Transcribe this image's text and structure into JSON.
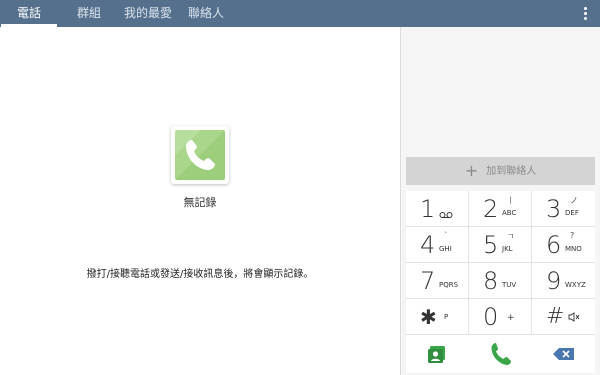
{
  "tabs": [
    {
      "label": "電話",
      "active": true
    },
    {
      "label": "群組",
      "active": false
    },
    {
      "label": "我的最愛",
      "active": false
    },
    {
      "label": "聯絡人",
      "active": false
    }
  ],
  "overflow_icon": "more-vertical-icon",
  "empty_state": {
    "icon": "phone-icon",
    "title": "無記錄",
    "description": "撥打/接聽電話或發送/接收訊息後，將會顯示記錄。"
  },
  "dialpad": {
    "add_contact_label": "加到聯絡人",
    "keys": [
      {
        "digit": "1",
        "letters": "",
        "symbol": "voicemail"
      },
      {
        "digit": "2",
        "letters": "ABC",
        "symbol": "ㅣ"
      },
      {
        "digit": "3",
        "letters": "DEF",
        "symbol": "ノ"
      },
      {
        "digit": "4",
        "letters": "GHI",
        "symbol": "`"
      },
      {
        "digit": "5",
        "letters": "JKL",
        "symbol": "ㄱ"
      },
      {
        "digit": "6",
        "letters": "MNO",
        "symbol": "?"
      },
      {
        "digit": "7",
        "letters": "PQRS",
        "symbol": ""
      },
      {
        "digit": "8",
        "letters": "TUV",
        "symbol": ""
      },
      {
        "digit": "9",
        "letters": "WXYZ",
        "symbol": ""
      },
      {
        "digit": "✱",
        "letters": "P",
        "symbol": ""
      },
      {
        "digit": "0",
        "letters": "+",
        "symbol": ""
      },
      {
        "digit": "#",
        "letters": "",
        "symbol": "mute-icon"
      }
    ],
    "actions": [
      {
        "name": "contacts-card-icon"
      },
      {
        "name": "call-icon"
      },
      {
        "name": "backspace-icon"
      }
    ]
  },
  "colors": {
    "tabbar": "#55708c",
    "tile_green": "#a9d68a",
    "call_green": "#3aa64a",
    "backspace_blue": "#4a77b0"
  }
}
